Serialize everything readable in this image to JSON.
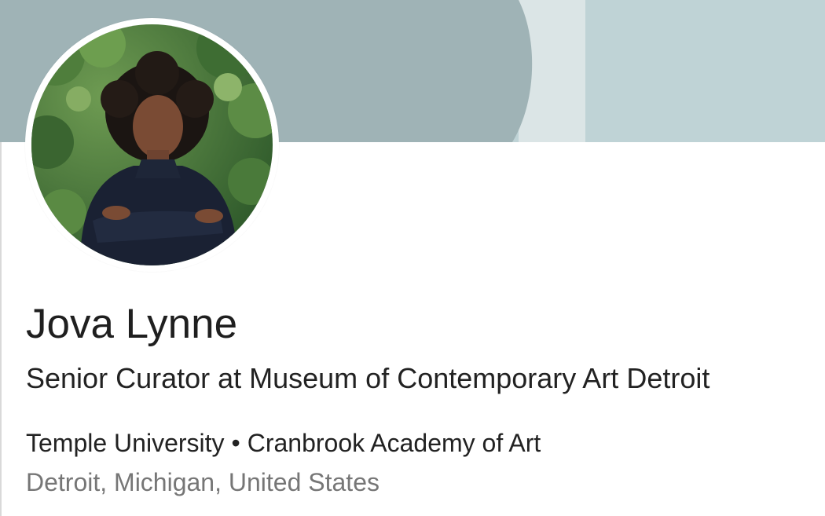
{
  "profile": {
    "name": "Jova Lynne",
    "headline": "Senior Curator at Museum of Contemporary Art Detroit",
    "education": {
      "school_1": "Temple University",
      "separator": "•",
      "school_2": "Cranbrook Academy of Art"
    },
    "location": "Detroit, Michigan, United States"
  },
  "colors": {
    "cover_dark": "#9fb3b6",
    "cover_light": "#bfd3d6",
    "cover_accent": "#dbe5e6",
    "name_text": "#1f1f1f",
    "body_text": "#222222",
    "muted_text": "#767676"
  }
}
